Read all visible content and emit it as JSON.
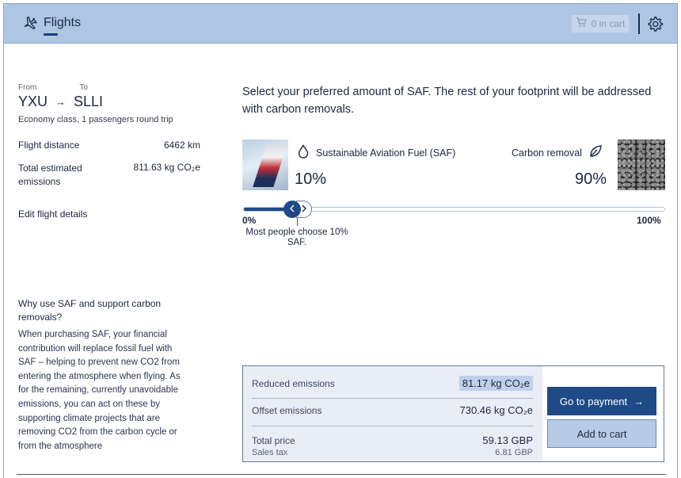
{
  "header": {
    "tab_label": "Flights",
    "tab_icon": "airplane-icon",
    "cart_label": "0 in cart",
    "cart_icon": "cart-icon",
    "settings_icon": "gear-icon"
  },
  "flight": {
    "from_label": "From",
    "to_label": "To",
    "from_code": "YXU",
    "arrow": "→",
    "to_code": "SLLI",
    "class_info": "Economy class, 1 passengers round trip",
    "distance_label": "Flight distance",
    "distance_value": "6462 km",
    "emissions_label": "Total estimated emissions",
    "emissions_value": "811.63 kg CO₂e",
    "edit_label": "Edit flight details"
  },
  "info": {
    "why_title": "Why use SAF and support carbon removals?",
    "why_body": "When purchasing SAF, your financial contribution will replace fossil fuel with SAF – helping to prevent new CO2 from entering the atmosphere when flying. As for the remaining, currently unavoidable emissions, you can act on these by supporting climate projects that are removing CO2 from the carbon cycle or from the atmosphere"
  },
  "selector": {
    "headline": "Select your preferred amount of SAF. The rest of your footprint will be addressed with carbon removals.",
    "saf_label": "Sustainable Aviation Fuel (SAF)",
    "saf_icon": "droplet-icon",
    "saf_percent": "10%",
    "saf_fraction": 0.1,
    "cr_label": "Carbon removal",
    "cr_icon": "leaf-icon",
    "cr_percent": "90%",
    "min_label": "0%",
    "max_label": "100%",
    "hint": "Most people choose 10% SAF."
  },
  "summary": {
    "reduced_label": "Reduced emissions",
    "reduced_value": "81.17 kg CO₂e",
    "offset_label": "Offset emissions",
    "offset_value": "730.46 kg CO₂e",
    "total_label": "Total price",
    "total_value": "59.13 GBP",
    "tax_label": "Sales tax",
    "tax_value": "6.81 GBP",
    "pay_label": "Go to payment",
    "pay_arrow": "→",
    "add_label": "Add to cart"
  },
  "colors": {
    "header_bg": "#aec5e4",
    "primary": "#1f4a86",
    "summary_bg": "#e9eef6",
    "highlight": "#bed0ea"
  }
}
